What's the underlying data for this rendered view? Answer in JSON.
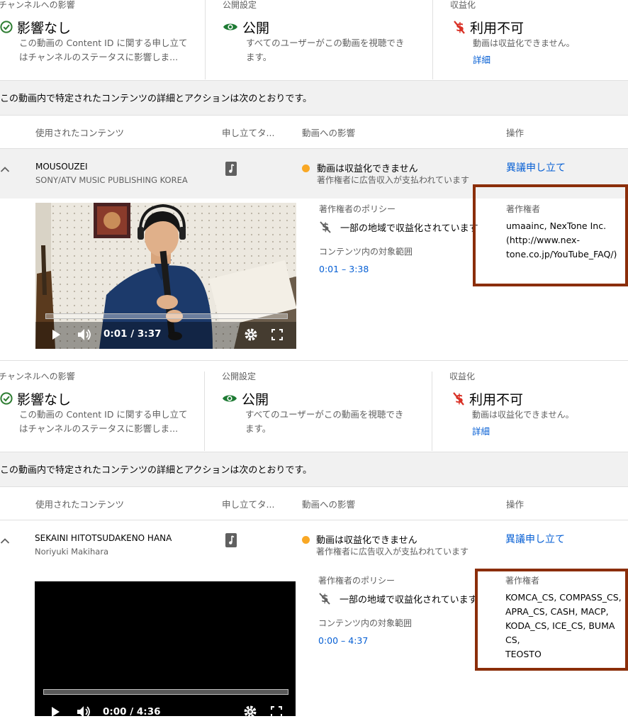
{
  "sections": [
    {
      "summary": {
        "channel": {
          "header": "チャンネルへの影響",
          "status": "影響なし",
          "desc_line1": "この動画の Content ID に関する申し立て",
          "desc_line2": "はチャンネルのステータスに影響しま..."
        },
        "visibility": {
          "header": "公開設定",
          "status": "公開",
          "desc_line1": "すべてのユーザーがこの動画を視聴でき",
          "desc_line2": "ます。"
        },
        "monetization": {
          "header": "収益化",
          "status": "利用不可",
          "desc": "動画は収益化できません。",
          "link": "詳細"
        }
      },
      "intro": "この動画内で特定されたコンテンツの詳細とアクションは次のとおりです。",
      "columns": {
        "content": "使用されたコンテンツ",
        "claim_type": "申し立てタ...",
        "impact": "動画への影響",
        "actions": "操作"
      },
      "claim": {
        "title": "MOUSOUZEI",
        "subtitle": "SONY/ATV MUSIC PUBLISHING KOREA",
        "impact": "動画は収益化できません",
        "impact_sub": "著作権者に広告収入が支払われています",
        "action": "異議申し立て",
        "policy_header": "著作権者のポリシー",
        "policy": "一部の地域で収益化されています",
        "range_header": "コンテンツ内の対象範囲",
        "range": "0:01 – 3:38",
        "owner_header": "著作権者",
        "owner_lines": [
          "umaainc, NexTone Inc.",
          "(http://www.nex-",
          "tone.co.jp/YouTube_FAQ/)"
        ],
        "video_time": "0:01 / 3:37",
        "video_progress": 0.005
      }
    },
    {
      "summary": {
        "channel": {
          "header": "チャンネルへの影響",
          "status": "影響なし",
          "desc_line1": "この動画の Content ID に関する申し立て",
          "desc_line2": "はチャンネルのステータスに影響しま..."
        },
        "visibility": {
          "header": "公開設定",
          "status": "公開",
          "desc_line1": "すべてのユーザーがこの動画を視聴でき",
          "desc_line2": "ます。"
        },
        "monetization": {
          "header": "収益化",
          "status": "利用不可",
          "desc": "動画は収益化できません。",
          "link": "詳細"
        }
      },
      "intro": "この動画内で特定されたコンテンツの詳細とアクションは次のとおりです。",
      "columns": {
        "content": "使用されたコンテンツ",
        "claim_type": "申し立てタ...",
        "impact": "動画への影響",
        "actions": "操作"
      },
      "claim": {
        "title": "SEKAINI HITOTSUDAKENO HANA",
        "subtitle": "Noriyuki Makihara",
        "impact": "動画は収益化できません",
        "impact_sub": "著作権者に広告収入が支払われています",
        "action": "異議申し立て",
        "policy_header": "著作権者のポリシー",
        "policy": "一部の地域で収益化されています",
        "range_header": "コンテンツ内の対象範囲",
        "range": "0:00 – 4:37",
        "owner_header": "著作権者",
        "owner_lines": [
          "KOMCA_CS, COMPASS_CS,",
          "APRA_CS, CASH, MACP,",
          "KODA_CS, ICE_CS, BUMA CS,",
          "TEOSTO"
        ],
        "video_time": "0:00 / 4:36",
        "video_progress": 0.0
      }
    }
  ],
  "colors": {
    "link": "#065fd4",
    "check": "#2e7d32",
    "eye": "#1e7b34",
    "no_money": "#d93025",
    "highlight_box": "#8b2e0a",
    "status_dot": "#f9a825"
  },
  "icons": [
    "check-circle-icon",
    "eye-icon",
    "no-money-icon",
    "chevron-up-icon",
    "music-note-icon",
    "play-icon",
    "volume-icon",
    "gear-icon",
    "fullscreen-icon"
  ]
}
